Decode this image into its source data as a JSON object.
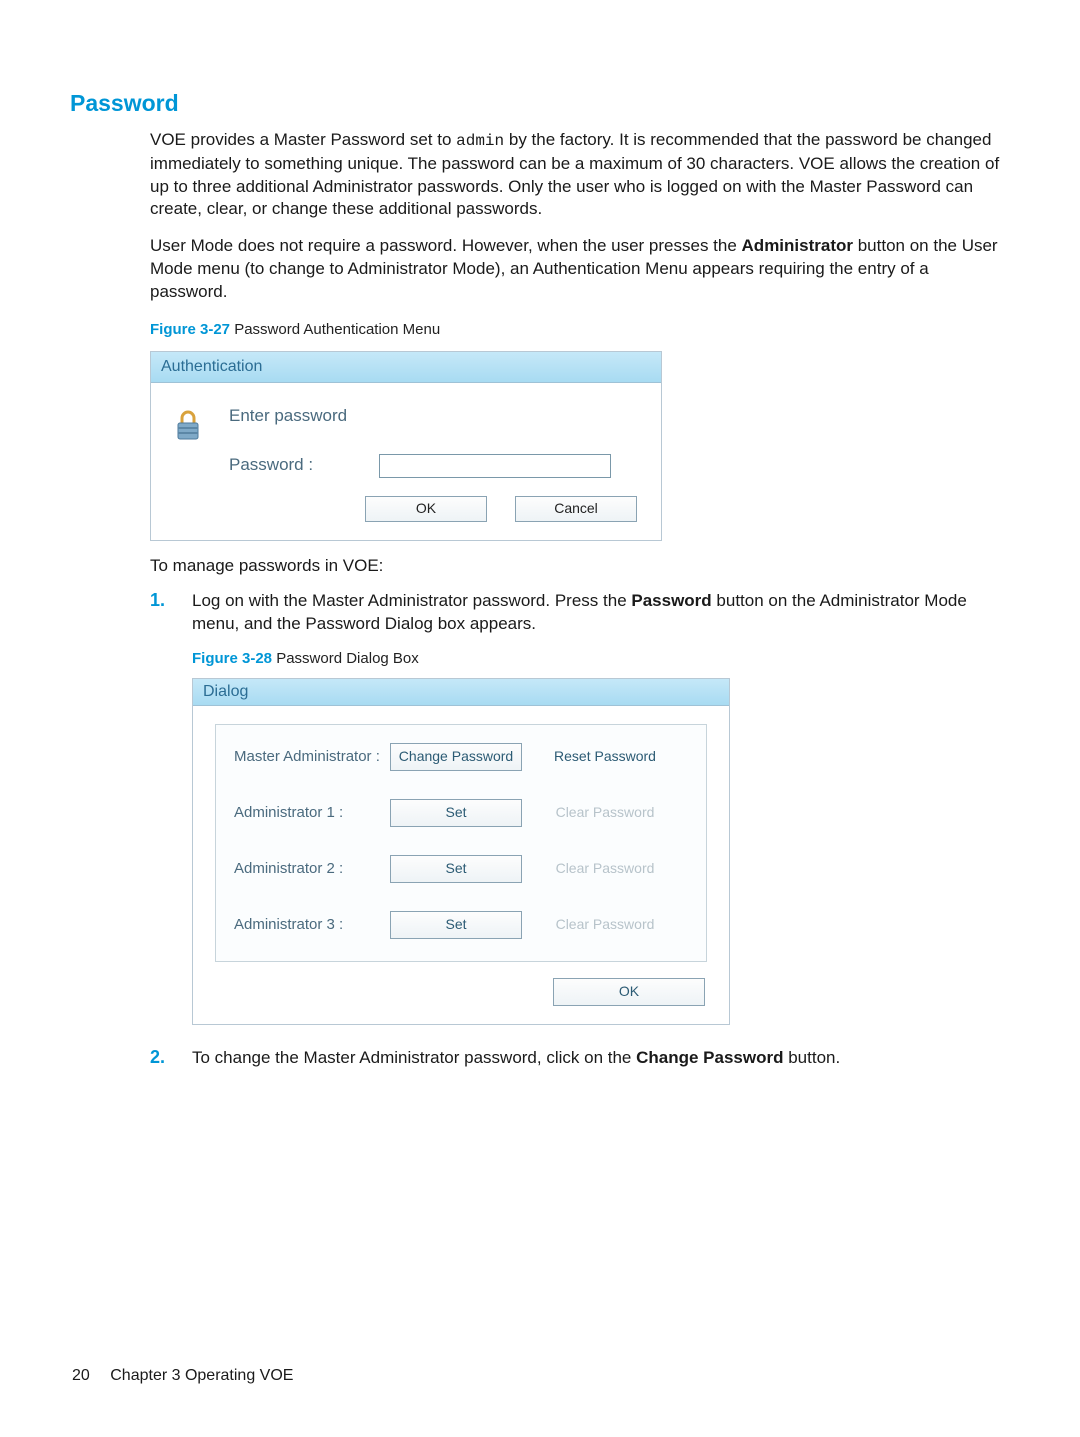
{
  "heading": "Password",
  "para1_a": "VOE provides a Master Password set to ",
  "para1_code": "admin",
  "para1_b": " by the factory. It is recommended that the password be changed immediately to something unique. The password can be a maximum of 30 characters. VOE allows the creation of up to three additional Administrator passwords. Only the user who is logged on with the Master Password can create, clear, or change these additional passwords.",
  "para2_a": "User Mode does not require a password. However, when the user presses the ",
  "para2_bold": "Administrator",
  "para2_b": " button on the User Mode menu (to change to Administrator Mode), an Authentication Menu appears requiring the entry of a password.",
  "fig27_cap": "Figure 3-27",
  "fig27_title": "  Password Authentication Menu",
  "auth": {
    "title": "Authentication",
    "prompt": "Enter password",
    "label": "Password :",
    "ok": "OK",
    "cancel": "Cancel"
  },
  "manage_line": "To manage passwords in VOE:",
  "step1_num": "1.",
  "step1_a": "Log on with the Master Administrator password. Press the ",
  "step1_bold": "Password",
  "step1_b": " button on the Administrator Mode menu, and the Password Dialog box appears.",
  "fig28_cap": "Figure 3-28",
  "fig28_title": "  Password Dialog Box",
  "dialog": {
    "title": "Dialog",
    "rows": [
      {
        "label": "Master Administrator :",
        "b1": "Change Password",
        "b2": "Reset Password",
        "b1_type": "btn",
        "b2_type": "flat"
      },
      {
        "label": "Administrator 1 :",
        "b1": "Set",
        "b2": "Clear Password",
        "b1_type": "btn",
        "b2_type": "disabled"
      },
      {
        "label": "Administrator 2 :",
        "b1": "Set",
        "b2": "Clear Password",
        "b1_type": "btn",
        "b2_type": "disabled"
      },
      {
        "label": "Administrator 3 :",
        "b1": "Set",
        "b2": "Clear Password",
        "b1_type": "btn",
        "b2_type": "disabled"
      }
    ],
    "ok": "OK"
  },
  "step2_num": "2.",
  "step2_a": "To change the Master Administrator password, click on the ",
  "step2_bold": "Change Password",
  "step2_b": " button.",
  "footer": {
    "page": "20",
    "chapter": "Chapter 3   Operating VOE"
  }
}
